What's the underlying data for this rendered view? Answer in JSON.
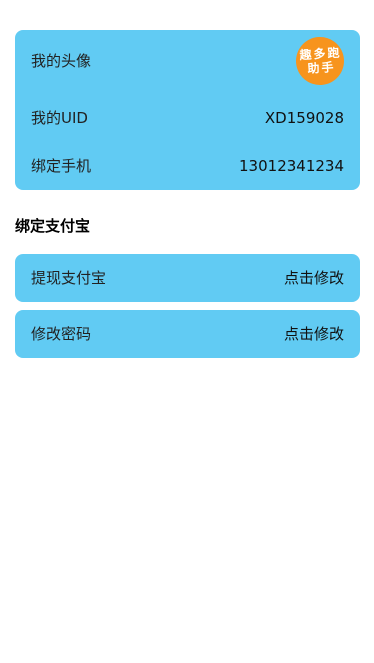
{
  "profile": {
    "avatar_label": "我的头像",
    "avatar_text_line1": "趣多跑",
    "avatar_text_line2": "助手",
    "uid_label": "我的UID",
    "uid_value": "XD159028",
    "phone_label": "绑定手机",
    "phone_value": "13012341234"
  },
  "section": {
    "title": "绑定支付宝"
  },
  "actions": [
    {
      "label": "提现支付宝",
      "action": "点击修改"
    },
    {
      "label": "修改密码",
      "action": "点击修改"
    }
  ],
  "colors": {
    "card": "#61cbf3",
    "avatar_bg": "#f7941d"
  }
}
